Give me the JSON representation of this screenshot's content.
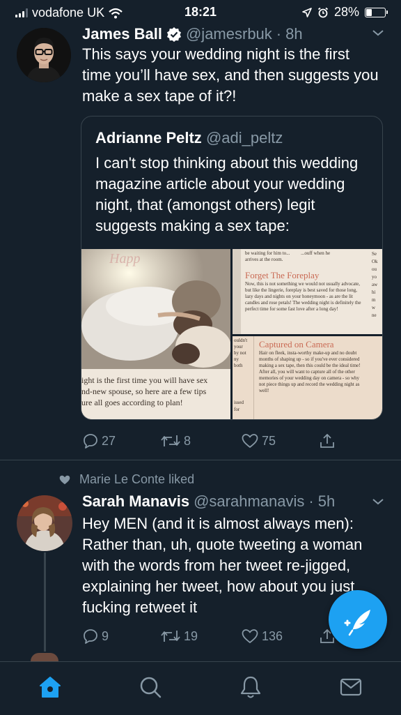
{
  "status_bar": {
    "carrier": "vodafone UK",
    "time": "18:21",
    "battery": "28%",
    "battery_level": 0.28
  },
  "tweet1": {
    "name": "James Ball",
    "handle": "@jamesrbuk",
    "time": "8h",
    "text": "This says your wedding night is the first time you’ll have sex, and then suggests you make a sex tape of it?!",
    "quote": {
      "name": "Adrianne Peltz",
      "handle": "@adi_peltz",
      "text": "I can't stop thinking about this wedding magazine article about your wedding night, that (amongst others) legit suggests making a sex tape:",
      "media": {
        "photo_caption": "ight is the first time you will have sex\nnd-new spouse, so here are a few tips\nure all goes according to plan!",
        "top_snippet": "be waiting for him to...         ...ouff when he\narrives at the room.",
        "heading1": "Forget The Foreplay",
        "body1": "Now, this is not something we would not usually advocate, but like the lingerie, foreplay is best saved for those long, lazy days and nights on your honeymoon - as are the lit candles and rose petals! The wedding night is definitely the perfect time for some fast love after a long day!",
        "heading2": "Captured on Camera",
        "body2": "Hair on fleek, insta-worthy make-up and no doubt months of shaping up - so if you've ever considered making a sex tape, then this could be the ideal time! After all, you will want to capture all of the other memories of your wedding day on camera - so why not piece things up and record the wedding night as well!",
        "left_fragments": "ouldn't\nyour\nhy not\nny\nboth",
        "left_fragments2": "issed\nfor",
        "right_fragments": "Se\nOk\nou\nyo\naw\nhi\nm\nw\nne"
      }
    },
    "replies": "27",
    "retweets": "8",
    "likes": "75"
  },
  "liked_by": "Marie Le Conte liked",
  "tweet2": {
    "name": "Sarah Manavis",
    "handle": "@sarahmanavis",
    "time": "5h",
    "text": "Hey MEN (and it is almost always men): Rather than, uh, quote tweeting a woman with the words from her tweet re-jigged, explaining her tweet, how about you just fucking retweet it",
    "replies": "9",
    "retweets": "19",
    "likes": "136"
  },
  "colors": {
    "background": "#15202b",
    "secondary_text": "#8899a6",
    "accent": "#1da1f2",
    "border": "#38444d"
  },
  "icons": [
    "signal-icon",
    "wifi-icon",
    "location-icon",
    "alarm-icon",
    "battery-icon",
    "verified-badge-icon",
    "chevron-down-icon",
    "reply-icon",
    "retweet-icon",
    "like-icon",
    "share-icon",
    "heart-small-icon",
    "compose-tweet-icon",
    "home-icon",
    "search-icon",
    "notifications-icon",
    "messages-icon"
  ]
}
